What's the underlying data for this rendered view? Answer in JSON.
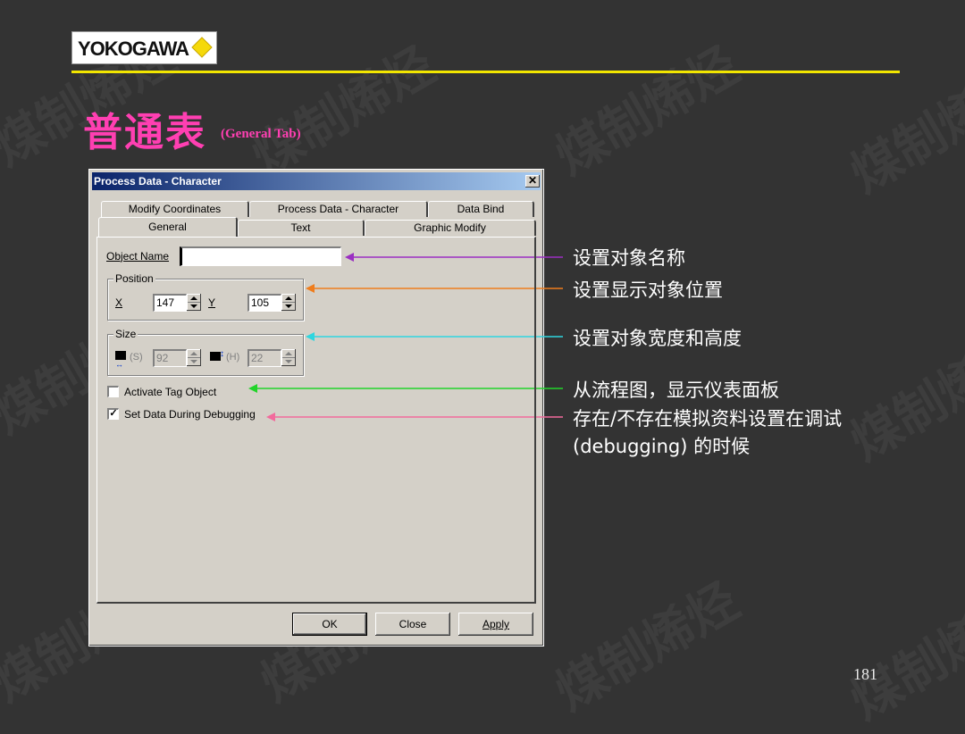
{
  "header": {
    "logo_text": "YOKOGAWA",
    "title": "普通表",
    "subtitle": "(General Tab)"
  },
  "watermark": "煤制烯烃",
  "dialog": {
    "title": "Process Data - Character",
    "close_glyph": "✕",
    "tabs_back": [
      "Modify Coordinates",
      "Process Data - Character",
      "Data Bind"
    ],
    "tabs_front": [
      "General",
      "Text",
      "Graphic Modify"
    ],
    "active_tab": "General",
    "object_name": {
      "label": "Object Name",
      "value": ""
    },
    "position": {
      "label": "Position",
      "x_label": "X",
      "x_value": "147",
      "y_label": "Y",
      "y_value": "105"
    },
    "size": {
      "label": "Size",
      "w_label": "(S)",
      "w_value": "92",
      "h_label": "(H)",
      "h_value": "22"
    },
    "activate_tag": {
      "label": "Activate Tag Object",
      "checked": false
    },
    "set_data": {
      "label": "Set Data During Debugging",
      "checked": true,
      "check_glyph": "✓"
    },
    "buttons": {
      "ok": "OK",
      "close": "Close",
      "apply": "Apply"
    }
  },
  "annotations": [
    {
      "text": "设置对象名称",
      "color": "#9b2fc2"
    },
    {
      "text": "设置显示对象位置",
      "color": "#ef7d1d"
    },
    {
      "text": "设置对象宽度和高度",
      "color": "#2fd6df"
    },
    {
      "text": "从流程图，显示仪表面板",
      "color": "#22d42a"
    },
    {
      "text": "存在/不存在模拟资料设置在调试",
      "color": "#f26a9c"
    },
    {
      "text": "(debugging) 的时候",
      "color": "#f26a9c"
    }
  ],
  "page_number": "181",
  "colors": {
    "background": "#333333",
    "rule": "#f2e600",
    "title": "#ff3fb2",
    "logo_diamond": "#f5d90a"
  }
}
